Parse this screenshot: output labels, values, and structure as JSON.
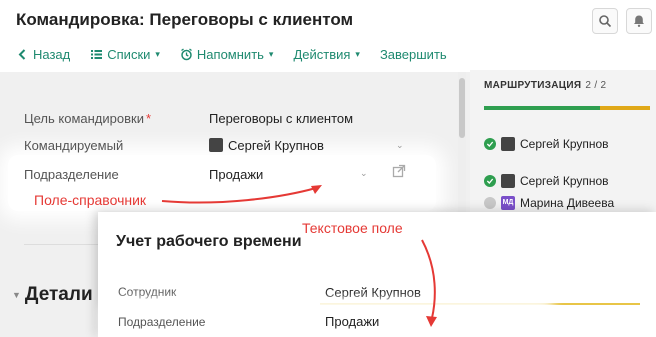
{
  "header": {
    "title": "Командировка: Переговоры с клиентом",
    "search_icon": "search-icon",
    "bell_icon": "bell-icon"
  },
  "toolbar": {
    "back": "Назад",
    "lists": "Списки",
    "remind": "Напомнить",
    "actions": "Действия",
    "finish": "Завершить"
  },
  "form": {
    "purpose_label": "Цель командировки",
    "purpose_value": "Переговоры с клиентом",
    "traveler_label": "Командируемый",
    "traveler_value": "Сергей Крупнов",
    "department_label": "Подразделение",
    "department_value": "Продажи"
  },
  "routing": {
    "title": "МАРШРУТИЗАЦИЯ",
    "count": "2 / 2",
    "items": [
      {
        "name": "Сергей Крупнов",
        "status": "done"
      },
      {
        "name": "Сергей Крупнов",
        "status": "done"
      },
      {
        "name": "Марина Дивеева",
        "status": "pending",
        "initials": "МД"
      }
    ]
  },
  "details": {
    "label": "Детали"
  },
  "card": {
    "title": "Учет рабочего времени",
    "employee_label": "Сотрудник",
    "employee_value": "Сергей Крупнов",
    "department_label": "Подразделение",
    "department_value": "Продажи"
  },
  "annotations": {
    "reference_field": "Поле-справочник",
    "text_field": "Текстовое поле"
  },
  "colors": {
    "accent": "#1f8a70",
    "annotation": "#e53935",
    "route_done": "#2e9e4f",
    "route_pending": "#e0a818"
  }
}
